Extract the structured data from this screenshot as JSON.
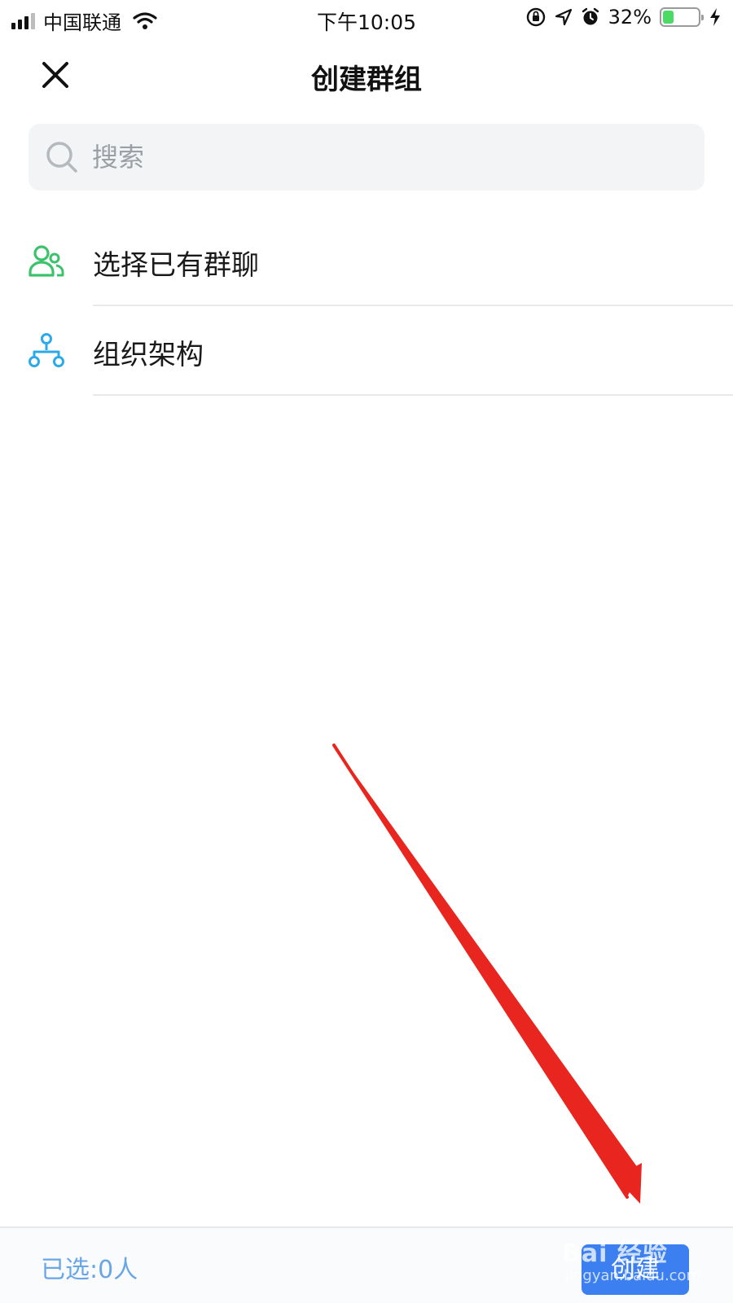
{
  "status_bar": {
    "carrier": "中国联通",
    "time": "下午10:05",
    "battery_percent_label": "32%",
    "battery_level": 0.32,
    "icons": [
      "signal-icon",
      "wifi-icon",
      "orientation-lock-icon",
      "location-icon",
      "alarm-icon",
      "battery-icon",
      "charging-icon"
    ]
  },
  "nav": {
    "title": "创建群组",
    "close_icon": "close-icon"
  },
  "search": {
    "placeholder": "搜索",
    "value": "",
    "icon": "search-icon"
  },
  "options": [
    {
      "label": "选择已有群聊",
      "icon": "group-chat-icon",
      "icon_color": "#3cc26b"
    },
    {
      "label": "组织架构",
      "icon": "org-structure-icon",
      "icon_color": "#2ba9e8"
    }
  ],
  "bottom_bar": {
    "selected_label": "已选:0人",
    "create_label": "创建"
  },
  "watermark": {
    "main": "Bai 经验",
    "sub": "jingyan.baidu.com"
  },
  "colors": {
    "accent": "#3c7ff0",
    "selected_text": "#6aa6e6",
    "annotation_arrow": "#e8261f",
    "battery_fill": "#4cd964"
  }
}
